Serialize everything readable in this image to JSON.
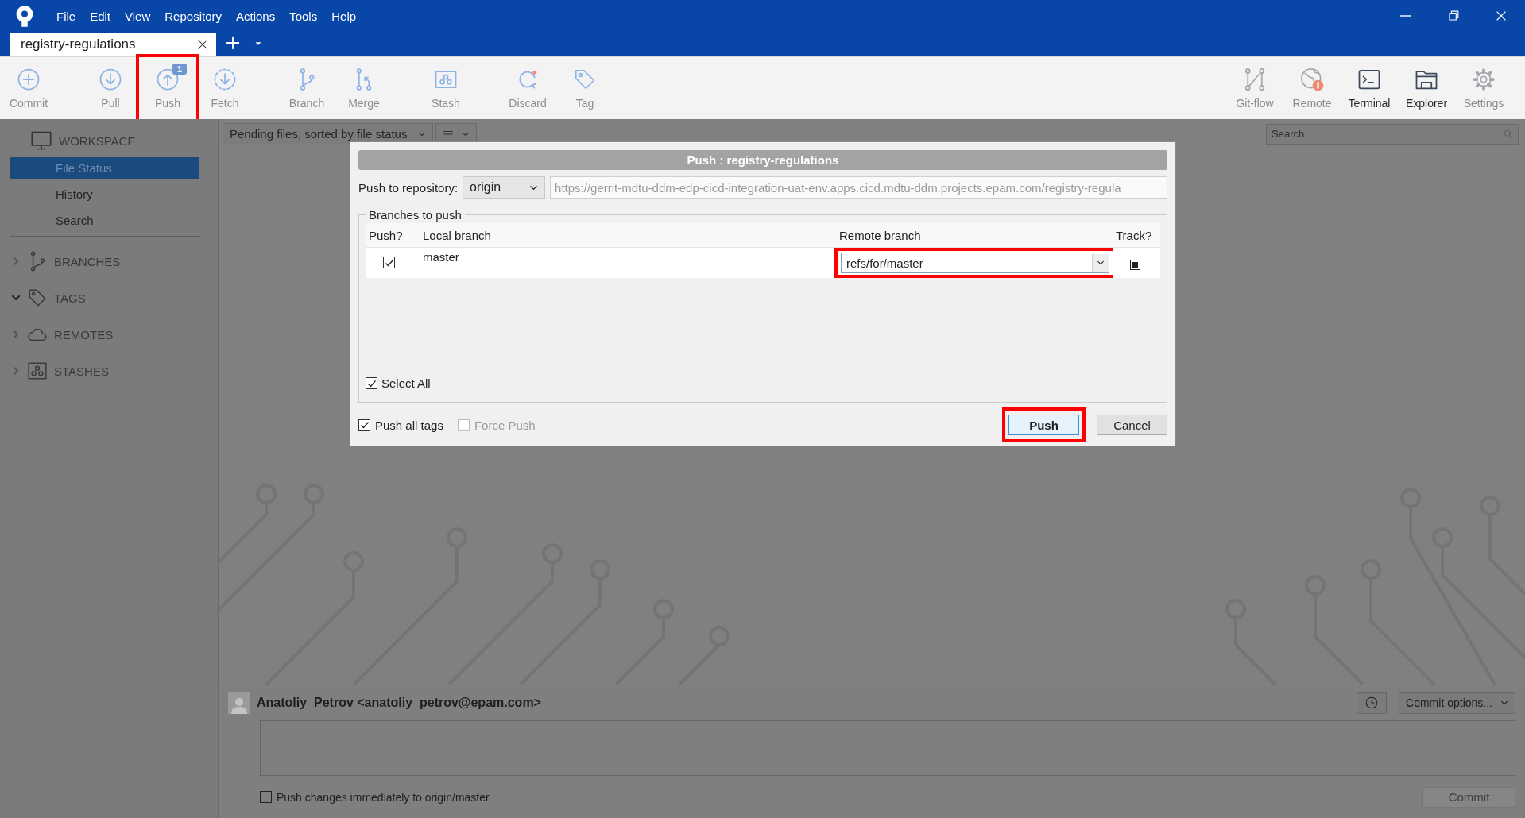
{
  "title_bar": {
    "menu": [
      "File",
      "Edit",
      "View",
      "Repository",
      "Actions",
      "Tools",
      "Help"
    ],
    "tabs": [
      {
        "label": "registry-regulations",
        "selected": true
      }
    ]
  },
  "toolbar": {
    "left": [
      {
        "label": "Commit",
        "disabled": true,
        "highlighted": false
      },
      {
        "label": "Pull",
        "disabled": true,
        "highlighted": false
      },
      {
        "label": "Push",
        "badge": "1",
        "disabled": true,
        "highlighted": true
      },
      {
        "label": "Fetch",
        "disabled": true,
        "highlighted": false
      },
      {
        "label": "Branch",
        "disabled": true,
        "highlighted": false
      },
      {
        "label": "Merge",
        "disabled": true,
        "highlighted": false
      },
      {
        "label": "Stash",
        "disabled": true,
        "highlighted": false
      },
      {
        "label": "Discard",
        "disabled": true,
        "highlighted": false
      },
      {
        "label": "Tag",
        "disabled": true,
        "highlighted": false
      }
    ],
    "right": [
      {
        "label": "Git-flow",
        "disabled": true
      },
      {
        "label": "Remote",
        "disabled": true
      },
      {
        "label": "Terminal",
        "disabled": false
      },
      {
        "label": "Explorer",
        "disabled": false
      },
      {
        "label": "Settings",
        "disabled": true
      }
    ]
  },
  "sidebar": {
    "workspace": {
      "label": "WORKSPACE",
      "items": [
        {
          "label": "File Status",
          "selected": true
        },
        {
          "label": "History",
          "selected": false
        },
        {
          "label": "Search",
          "selected": false
        }
      ]
    },
    "sections": [
      {
        "label": "BRANCHES",
        "expanded": false
      },
      {
        "label": "TAGS",
        "expanded": true
      },
      {
        "label": "REMOTES",
        "expanded": false
      },
      {
        "label": "STASHES",
        "expanded": false
      }
    ]
  },
  "file_view": {
    "sort_dropdown": "Pending files, sorted by file status",
    "search": {
      "placeholder": "Search"
    }
  },
  "push_dialog": {
    "title": "Push :  registry-regulations",
    "repository_label": "Push to repository:",
    "repository": "origin",
    "url": "https://gerrit-mdtu-ddm-edp-cicd-integration-uat-env.apps.cicd.mdtu-ddm.projects.epam.com/registry-regula",
    "branches_group": "Branches to push",
    "columns": [
      "Push?",
      "Local branch",
      "Remote branch",
      "Track?"
    ],
    "rows": [
      {
        "push": true,
        "local_branch": "master",
        "remote_branch": "refs/for/master",
        "track": true,
        "highlighted": true
      }
    ],
    "select_all": {
      "label": "Select All",
      "checked": true
    },
    "push_all_tags": {
      "label": "Push all tags",
      "checked": true,
      "disabled": false
    },
    "force_push": {
      "label": "Force Push",
      "checked": false,
      "disabled": true
    },
    "buttons": [
      {
        "label": "Push",
        "default": true,
        "highlighted": true
      },
      {
        "label": "Cancel",
        "default": false,
        "highlighted": false
      }
    ]
  },
  "commit_panel": {
    "author": "Anatoliy_Petrov <anatoliy_petrov@epam.com>",
    "options_dropdown": "Commit options...",
    "push_immediately": {
      "label": "Push changes immediately to origin/master",
      "checked": false
    },
    "commit_button": {
      "label": "Commit",
      "disabled": true
    }
  }
}
